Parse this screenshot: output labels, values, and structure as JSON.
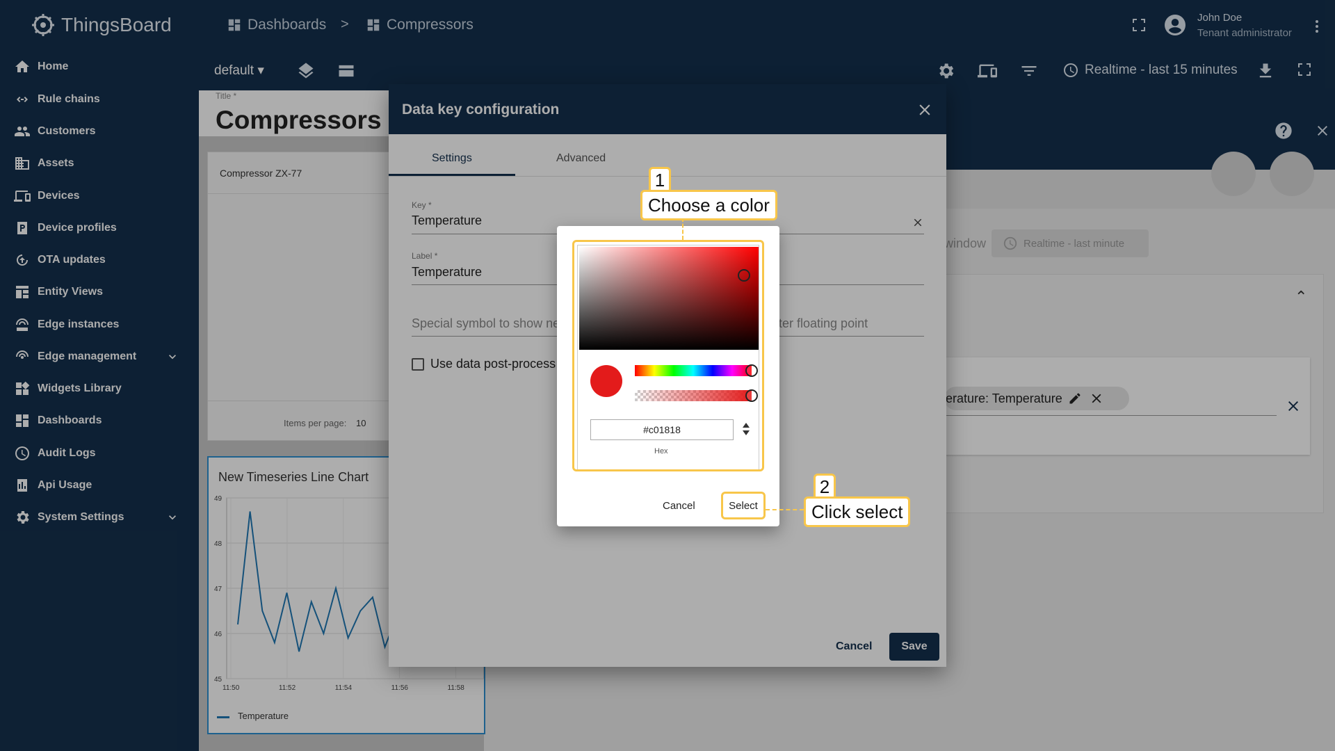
{
  "app": {
    "name": "ThingsBoard"
  },
  "breadcrumb": {
    "item1": "Dashboards",
    "sep": ">",
    "item2": "Compressors"
  },
  "user": {
    "name": "John Doe",
    "role": "Tenant administrator"
  },
  "toolbar": {
    "state": "default",
    "timewindow": "Realtime - last 15 minutes"
  },
  "sidebar": {
    "items": [
      {
        "label": "Home",
        "icon": "home-icon"
      },
      {
        "label": "Rule chains",
        "icon": "rule-chains-icon"
      },
      {
        "label": "Customers",
        "icon": "customers-icon"
      },
      {
        "label": "Assets",
        "icon": "assets-icon"
      },
      {
        "label": "Devices",
        "icon": "devices-icon"
      },
      {
        "label": "Device profiles",
        "icon": "device-profiles-icon"
      },
      {
        "label": "OTA updates",
        "icon": "ota-icon"
      },
      {
        "label": "Entity Views",
        "icon": "entity-views-icon"
      },
      {
        "label": "Edge instances",
        "icon": "edge-icon"
      },
      {
        "label": "Edge management",
        "icon": "edge-management-icon"
      },
      {
        "label": "Widgets Library",
        "icon": "widgets-icon"
      },
      {
        "label": "Dashboards",
        "icon": "dashboards-icon"
      },
      {
        "label": "Audit Logs",
        "icon": "audit-icon"
      },
      {
        "label": "Api Usage",
        "icon": "api-usage-icon"
      },
      {
        "label": "System Settings",
        "icon": "settings-icon"
      }
    ]
  },
  "dashboard": {
    "title_label": "Title *",
    "title": "Compressors",
    "table_row": "Compressor ZX-77",
    "items_per_page_label": "Items per page:",
    "items_per_page": "10",
    "chart_title": "New Timeseries Line Chart",
    "legend": "Temperature"
  },
  "background": {
    "window_text": "window",
    "realtime_chip": "Realtime - last minute",
    "key_chip": "erature: Temperature"
  },
  "dialog": {
    "title": "Data key configuration",
    "tabs": [
      "Settings",
      "Advanced"
    ],
    "key_label": "Key *",
    "key_value": "Temperature",
    "label_label": "Label *",
    "label_value": "Temperature",
    "special_symbol_placeholder": "Special symbol to show ne",
    "decimals_placeholder": "fter floating point",
    "postprocess_label": "Use data post-process",
    "cancel": "Cancel",
    "save": "Save"
  },
  "color_picker": {
    "hex": "#c01818",
    "hex_label": "Hex",
    "cancel": "Cancel",
    "select": "Select",
    "hue_fraction": 1.0,
    "alpha_fraction": 1.0
  },
  "callouts": [
    {
      "num": "1",
      "text": "Choose a color"
    },
    {
      "num": "2",
      "text": "Click select"
    }
  ],
  "chart_data": {
    "type": "line",
    "x": [
      "11:50",
      "11:51",
      "11:52",
      "11:53",
      "11:54",
      "11:55",
      "11:56",
      "11:57",
      "11:58",
      "11:59"
    ],
    "xticks": [
      "11:50",
      "11:52",
      "11:54",
      "11:56",
      "11:58"
    ],
    "yticks": [
      "45",
      "46",
      "47",
      "48",
      "49"
    ],
    "ylim": [
      45,
      49
    ],
    "series": [
      {
        "name": "Temperature",
        "values": [
          46.2,
          48.7,
          46.5,
          45.8,
          46.9,
          45.6,
          46.7,
          46.0,
          47.0,
          45.9,
          46.5,
          46.8,
          45.7,
          46.4,
          46.6,
          46.0,
          47.0,
          45.8,
          46.4,
          46.7
        ]
      }
    ]
  },
  "colors": {
    "primary": "#14304d",
    "accent": "#f8c64a",
    "line": "#1f78b4"
  }
}
